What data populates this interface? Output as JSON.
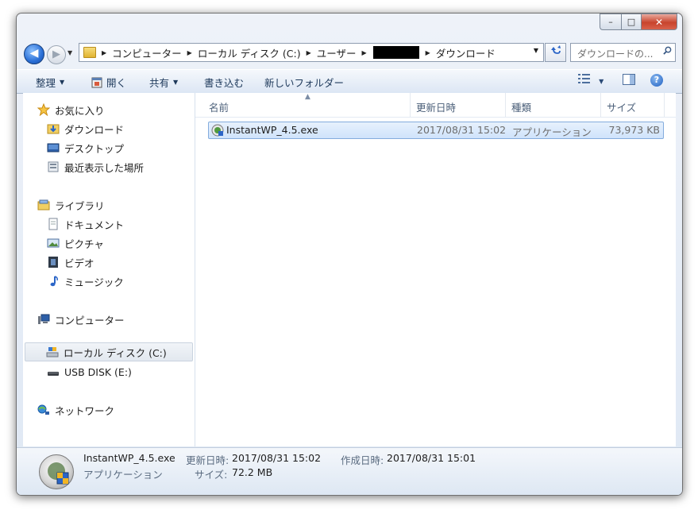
{
  "window": {
    "controls": {
      "minimize": "–",
      "maximize": "□",
      "close": "✕"
    }
  },
  "nav": {
    "back": "◀",
    "forward": "▶",
    "breadcrumb": [
      "コンピューター",
      "ローカル ディスク (C:)",
      "ユーザー",
      "ダウンロード"
    ],
    "search_placeholder": "ダウンロードの...",
    "icons": {
      "back": "arrow-left-icon",
      "forward": "arrow-right-icon",
      "refresh": "refresh-icon",
      "search": "magnifier-icon",
      "folder": "folder-icon"
    }
  },
  "toolbar": {
    "organize": "整理",
    "open": "開く",
    "share": "共有",
    "burn": "書き込む",
    "new_folder": "新しいフォルダー",
    "help": "?"
  },
  "sidebar": {
    "favorites": {
      "label": "お気に入り",
      "items": [
        "ダウンロード",
        "デスクトップ",
        "最近表示した場所"
      ]
    },
    "libraries": {
      "label": "ライブラリ",
      "items": [
        "ドキュメント",
        "ピクチャ",
        "ビデオ",
        "ミュージック"
      ]
    },
    "computer": {
      "label": "コンピューター",
      "items": [
        "ローカル ディスク (C:)",
        "USB DISK (E:)"
      ]
    },
    "network": {
      "label": "ネットワーク"
    }
  },
  "columns": {
    "name": "名前",
    "modified": "更新日時",
    "type": "種類",
    "size": "サイズ"
  },
  "files": [
    {
      "name": "InstantWP_4.5.exe",
      "modified": "2017/08/31 15:02",
      "type": "アプリケーション",
      "size": "73,973 KB"
    }
  ],
  "details": {
    "name": "InstantWP_4.5.exe",
    "type": "アプリケーション",
    "modified_label": "更新日時:",
    "modified": "2017/08/31 15:02",
    "created_label": "作成日時:",
    "created": "2017/08/31 15:01",
    "size_label": "サイズ:",
    "size": "72.2 MB"
  },
  "colors": {
    "accent": "#2b65c7",
    "selection": "#cfe3fb",
    "close": "#c8442d"
  }
}
